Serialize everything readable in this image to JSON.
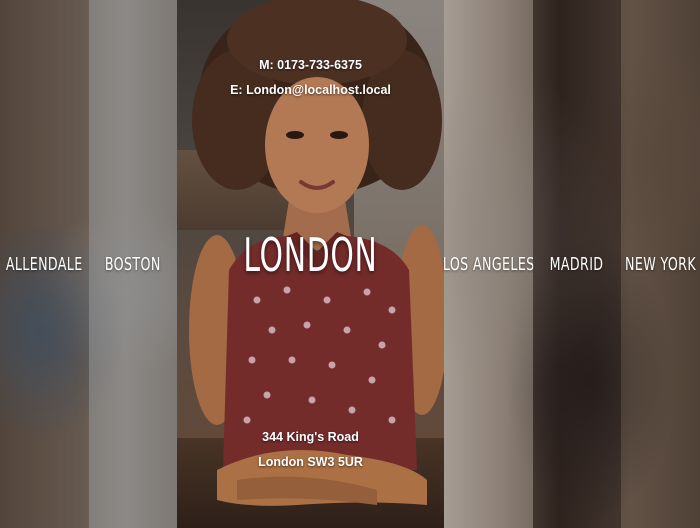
{
  "locations": {
    "allendale": {
      "label": "ALLENDALE"
    },
    "boston": {
      "label": "BOSTON"
    },
    "london": {
      "label": "LONDON",
      "phone": "M: 0173-733-6375",
      "email": "E: London@localhost.local",
      "address_line1": "344 King's Road",
      "address_line2": "London SW3 5UR"
    },
    "los_angeles": {
      "label": "LOS ANGELES"
    },
    "madrid": {
      "label": "MADRID"
    },
    "new_york": {
      "label": "NEW YORK"
    }
  },
  "active_location": "LONDON",
  "colors": {
    "text": "#ffffff",
    "boston_overlay": "#828282",
    "blouse": "#7a2a28"
  }
}
